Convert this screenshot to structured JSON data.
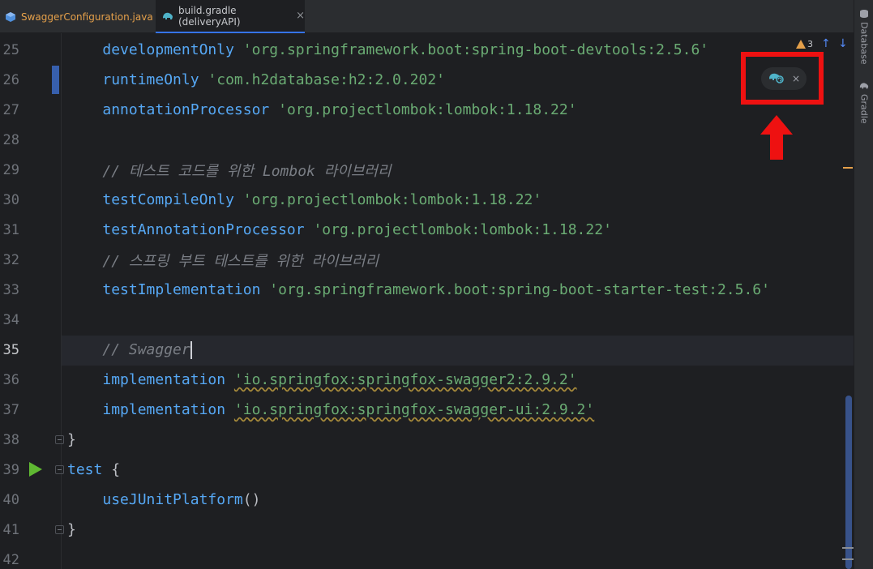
{
  "tabs": [
    {
      "label": "SwaggerConfiguration.java",
      "close": "×",
      "active": false
    },
    {
      "label": "build.gradle (deliveryAPI)",
      "close": "×",
      "active": true
    }
  ],
  "toolwindows": [
    {
      "label": "Database",
      "icon": "database-icon"
    },
    {
      "label": "Gradle",
      "icon": "gradle-elephant-icon"
    }
  ],
  "inspections": {
    "warning_count": "3"
  },
  "gradle_popup": {
    "icon": "gradle-reload-icon",
    "close": "×"
  },
  "lines": [
    {
      "num": "25",
      "tokens": [
        {
          "t": "    ",
          "c": "txt"
        },
        {
          "t": "developmentOnly",
          "c": "kw"
        },
        {
          "t": " ",
          "c": "txt"
        },
        {
          "t": "'org.springframework.boot:spring-boot-devtools:2.5.6'",
          "c": "str"
        }
      ]
    },
    {
      "num": "26",
      "tokens": [
        {
          "t": "    ",
          "c": "txt"
        },
        {
          "t": "runtimeOnly",
          "c": "kw"
        },
        {
          "t": " ",
          "c": "txt"
        },
        {
          "t": "'com.h2database:h2:2.0.202'",
          "c": "str"
        }
      ]
    },
    {
      "num": "27",
      "tokens": [
        {
          "t": "    ",
          "c": "txt"
        },
        {
          "t": "annotationProcessor",
          "c": "kw"
        },
        {
          "t": " ",
          "c": "txt"
        },
        {
          "t": "'org.projectlombok:lombok:1.18.22'",
          "c": "str"
        }
      ]
    },
    {
      "num": "28",
      "tokens": []
    },
    {
      "num": "29",
      "tokens": [
        {
          "t": "    ",
          "c": "txt"
        },
        {
          "t": "// 테스트 코드를 위한 Lombok 라이브러리",
          "c": "cmt"
        }
      ]
    },
    {
      "num": "30",
      "tokens": [
        {
          "t": "    ",
          "c": "txt"
        },
        {
          "t": "testCompileOnly",
          "c": "kw"
        },
        {
          "t": " ",
          "c": "txt"
        },
        {
          "t": "'org.projectlombok:lombok:1.18.22'",
          "c": "str"
        }
      ]
    },
    {
      "num": "31",
      "tokens": [
        {
          "t": "    ",
          "c": "txt"
        },
        {
          "t": "testAnnotationProcessor",
          "c": "kw"
        },
        {
          "t": " ",
          "c": "txt"
        },
        {
          "t": "'org.projectlombok:lombok:1.18.22'",
          "c": "str"
        }
      ]
    },
    {
      "num": "32",
      "tokens": [
        {
          "t": "    ",
          "c": "txt"
        },
        {
          "t": "// 스프링 부트 테스트를 위한 라이브러리",
          "c": "cmt"
        }
      ]
    },
    {
      "num": "33",
      "tokens": [
        {
          "t": "    ",
          "c": "txt"
        },
        {
          "t": "testImplementation",
          "c": "kw"
        },
        {
          "t": " ",
          "c": "txt"
        },
        {
          "t": "'org.springframework.boot:spring-boot-starter-test:2.5.6'",
          "c": "str"
        }
      ]
    },
    {
      "num": "34",
      "tokens": []
    },
    {
      "num": "35",
      "tokens": [
        {
          "t": "    ",
          "c": "txt"
        },
        {
          "t": "// Swagger",
          "c": "cmt"
        }
      ],
      "cursor": true
    },
    {
      "num": "36",
      "tokens": [
        {
          "t": "    ",
          "c": "txt"
        },
        {
          "t": "implementation",
          "c": "kw"
        },
        {
          "t": " ",
          "c": "txt"
        },
        {
          "t": "'io.springfox:springfox-swagger2:2.9.2'",
          "c": "str sq"
        }
      ]
    },
    {
      "num": "37",
      "tokens": [
        {
          "t": "    ",
          "c": "txt"
        },
        {
          "t": "implementation",
          "c": "kw"
        },
        {
          "t": " ",
          "c": "txt"
        },
        {
          "t": "'io.springfox:springfox-swagger-ui:2.9.2'",
          "c": "str sq"
        }
      ]
    },
    {
      "num": "38",
      "tokens": [
        {
          "t": "}",
          "c": "txt"
        }
      ]
    },
    {
      "num": "39",
      "tokens": [
        {
          "t": "test",
          "c": "kw"
        },
        {
          "t": " {",
          "c": "txt"
        }
      ]
    },
    {
      "num": "40",
      "tokens": [
        {
          "t": "    ",
          "c": "txt"
        },
        {
          "t": "useJUnitPlatform",
          "c": "kw"
        },
        {
          "t": "()",
          "c": "txt"
        }
      ]
    },
    {
      "num": "41",
      "tokens": [
        {
          "t": "}",
          "c": "txt"
        }
      ]
    },
    {
      "num": "42",
      "tokens": []
    }
  ],
  "colors": {
    "keyword": "#56a8f5",
    "string": "#6aab73",
    "comment": "#7a7e85",
    "highlight": "#ee1111",
    "run": "#5fb832"
  }
}
